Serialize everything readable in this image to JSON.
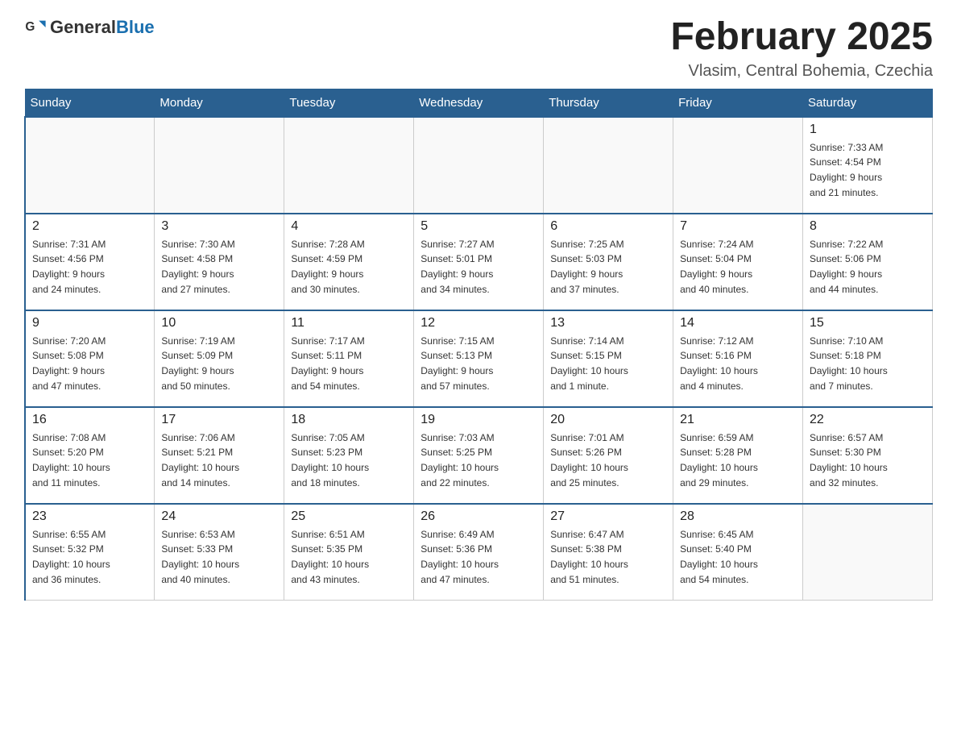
{
  "header": {
    "logo_general": "General",
    "logo_blue": "Blue",
    "month_title": "February 2025",
    "location": "Vlasim, Central Bohemia, Czechia"
  },
  "weekdays": [
    "Sunday",
    "Monday",
    "Tuesday",
    "Wednesday",
    "Thursday",
    "Friday",
    "Saturday"
  ],
  "weeks": [
    [
      {
        "day": "",
        "info": ""
      },
      {
        "day": "",
        "info": ""
      },
      {
        "day": "",
        "info": ""
      },
      {
        "day": "",
        "info": ""
      },
      {
        "day": "",
        "info": ""
      },
      {
        "day": "",
        "info": ""
      },
      {
        "day": "1",
        "info": "Sunrise: 7:33 AM\nSunset: 4:54 PM\nDaylight: 9 hours\nand 21 minutes."
      }
    ],
    [
      {
        "day": "2",
        "info": "Sunrise: 7:31 AM\nSunset: 4:56 PM\nDaylight: 9 hours\nand 24 minutes."
      },
      {
        "day": "3",
        "info": "Sunrise: 7:30 AM\nSunset: 4:58 PM\nDaylight: 9 hours\nand 27 minutes."
      },
      {
        "day": "4",
        "info": "Sunrise: 7:28 AM\nSunset: 4:59 PM\nDaylight: 9 hours\nand 30 minutes."
      },
      {
        "day": "5",
        "info": "Sunrise: 7:27 AM\nSunset: 5:01 PM\nDaylight: 9 hours\nand 34 minutes."
      },
      {
        "day": "6",
        "info": "Sunrise: 7:25 AM\nSunset: 5:03 PM\nDaylight: 9 hours\nand 37 minutes."
      },
      {
        "day": "7",
        "info": "Sunrise: 7:24 AM\nSunset: 5:04 PM\nDaylight: 9 hours\nand 40 minutes."
      },
      {
        "day": "8",
        "info": "Sunrise: 7:22 AM\nSunset: 5:06 PM\nDaylight: 9 hours\nand 44 minutes."
      }
    ],
    [
      {
        "day": "9",
        "info": "Sunrise: 7:20 AM\nSunset: 5:08 PM\nDaylight: 9 hours\nand 47 minutes."
      },
      {
        "day": "10",
        "info": "Sunrise: 7:19 AM\nSunset: 5:09 PM\nDaylight: 9 hours\nand 50 minutes."
      },
      {
        "day": "11",
        "info": "Sunrise: 7:17 AM\nSunset: 5:11 PM\nDaylight: 9 hours\nand 54 minutes."
      },
      {
        "day": "12",
        "info": "Sunrise: 7:15 AM\nSunset: 5:13 PM\nDaylight: 9 hours\nand 57 minutes."
      },
      {
        "day": "13",
        "info": "Sunrise: 7:14 AM\nSunset: 5:15 PM\nDaylight: 10 hours\nand 1 minute."
      },
      {
        "day": "14",
        "info": "Sunrise: 7:12 AM\nSunset: 5:16 PM\nDaylight: 10 hours\nand 4 minutes."
      },
      {
        "day": "15",
        "info": "Sunrise: 7:10 AM\nSunset: 5:18 PM\nDaylight: 10 hours\nand 7 minutes."
      }
    ],
    [
      {
        "day": "16",
        "info": "Sunrise: 7:08 AM\nSunset: 5:20 PM\nDaylight: 10 hours\nand 11 minutes."
      },
      {
        "day": "17",
        "info": "Sunrise: 7:06 AM\nSunset: 5:21 PM\nDaylight: 10 hours\nand 14 minutes."
      },
      {
        "day": "18",
        "info": "Sunrise: 7:05 AM\nSunset: 5:23 PM\nDaylight: 10 hours\nand 18 minutes."
      },
      {
        "day": "19",
        "info": "Sunrise: 7:03 AM\nSunset: 5:25 PM\nDaylight: 10 hours\nand 22 minutes."
      },
      {
        "day": "20",
        "info": "Sunrise: 7:01 AM\nSunset: 5:26 PM\nDaylight: 10 hours\nand 25 minutes."
      },
      {
        "day": "21",
        "info": "Sunrise: 6:59 AM\nSunset: 5:28 PM\nDaylight: 10 hours\nand 29 minutes."
      },
      {
        "day": "22",
        "info": "Sunrise: 6:57 AM\nSunset: 5:30 PM\nDaylight: 10 hours\nand 32 minutes."
      }
    ],
    [
      {
        "day": "23",
        "info": "Sunrise: 6:55 AM\nSunset: 5:32 PM\nDaylight: 10 hours\nand 36 minutes."
      },
      {
        "day": "24",
        "info": "Sunrise: 6:53 AM\nSunset: 5:33 PM\nDaylight: 10 hours\nand 40 minutes."
      },
      {
        "day": "25",
        "info": "Sunrise: 6:51 AM\nSunset: 5:35 PM\nDaylight: 10 hours\nand 43 minutes."
      },
      {
        "day": "26",
        "info": "Sunrise: 6:49 AM\nSunset: 5:36 PM\nDaylight: 10 hours\nand 47 minutes."
      },
      {
        "day": "27",
        "info": "Sunrise: 6:47 AM\nSunset: 5:38 PM\nDaylight: 10 hours\nand 51 minutes."
      },
      {
        "day": "28",
        "info": "Sunrise: 6:45 AM\nSunset: 5:40 PM\nDaylight: 10 hours\nand 54 minutes."
      },
      {
        "day": "",
        "info": ""
      }
    ]
  ]
}
